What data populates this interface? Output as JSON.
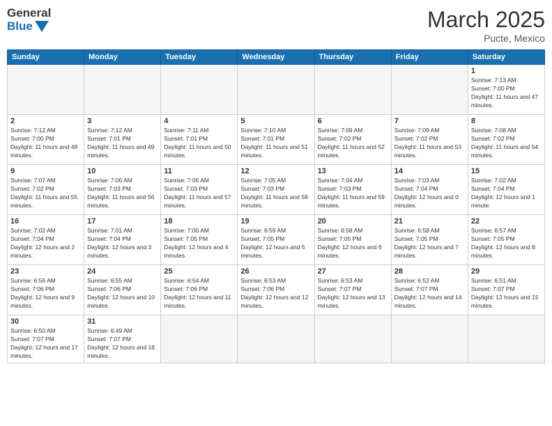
{
  "header": {
    "logo_general": "General",
    "logo_blue": "Blue",
    "month_title": "March 2025",
    "location": "Pucte, Mexico"
  },
  "weekdays": [
    "Sunday",
    "Monday",
    "Tuesday",
    "Wednesday",
    "Thursday",
    "Friday",
    "Saturday"
  ],
  "days": {
    "1": {
      "sunrise": "7:13 AM",
      "sunset": "7:00 PM",
      "daylight": "11 hours and 47 minutes."
    },
    "2": {
      "sunrise": "7:12 AM",
      "sunset": "7:00 PM",
      "daylight": "11 hours and 48 minutes."
    },
    "3": {
      "sunrise": "7:12 AM",
      "sunset": "7:01 PM",
      "daylight": "11 hours and 49 minutes."
    },
    "4": {
      "sunrise": "7:11 AM",
      "sunset": "7:01 PM",
      "daylight": "11 hours and 50 minutes."
    },
    "5": {
      "sunrise": "7:10 AM",
      "sunset": "7:01 PM",
      "daylight": "11 hours and 51 minutes."
    },
    "6": {
      "sunrise": "7:09 AM",
      "sunset": "7:02 PM",
      "daylight": "11 hours and 52 minutes."
    },
    "7": {
      "sunrise": "7:09 AM",
      "sunset": "7:02 PM",
      "daylight": "11 hours and 53 minutes."
    },
    "8": {
      "sunrise": "7:08 AM",
      "sunset": "7:02 PM",
      "daylight": "11 hours and 54 minutes."
    },
    "9": {
      "sunrise": "7:07 AM",
      "sunset": "7:02 PM",
      "daylight": "11 hours and 55 minutes."
    },
    "10": {
      "sunrise": "7:06 AM",
      "sunset": "7:03 PM",
      "daylight": "11 hours and 56 minutes."
    },
    "11": {
      "sunrise": "7:06 AM",
      "sunset": "7:03 PM",
      "daylight": "11 hours and 57 minutes."
    },
    "12": {
      "sunrise": "7:05 AM",
      "sunset": "7:03 PM",
      "daylight": "11 hours and 58 minutes."
    },
    "13": {
      "sunrise": "7:04 AM",
      "sunset": "7:03 PM",
      "daylight": "11 hours and 59 minutes."
    },
    "14": {
      "sunrise": "7:03 AM",
      "sunset": "7:04 PM",
      "daylight": "12 hours and 0 minutes."
    },
    "15": {
      "sunrise": "7:02 AM",
      "sunset": "7:04 PM",
      "daylight": "12 hours and 1 minute."
    },
    "16": {
      "sunrise": "7:02 AM",
      "sunset": "7:04 PM",
      "daylight": "12 hours and 2 minutes."
    },
    "17": {
      "sunrise": "7:01 AM",
      "sunset": "7:04 PM",
      "daylight": "12 hours and 3 minutes."
    },
    "18": {
      "sunrise": "7:00 AM",
      "sunset": "7:05 PM",
      "daylight": "12 hours and 4 minutes."
    },
    "19": {
      "sunrise": "6:59 AM",
      "sunset": "7:05 PM",
      "daylight": "12 hours and 5 minutes."
    },
    "20": {
      "sunrise": "6:58 AM",
      "sunset": "7:05 PM",
      "daylight": "12 hours and 6 minutes."
    },
    "21": {
      "sunrise": "6:58 AM",
      "sunset": "7:05 PM",
      "daylight": "12 hours and 7 minutes."
    },
    "22": {
      "sunrise": "6:57 AM",
      "sunset": "7:05 PM",
      "daylight": "12 hours and 8 minutes."
    },
    "23": {
      "sunrise": "6:56 AM",
      "sunset": "7:06 PM",
      "daylight": "12 hours and 9 minutes."
    },
    "24": {
      "sunrise": "6:55 AM",
      "sunset": "7:06 PM",
      "daylight": "12 hours and 10 minutes."
    },
    "25": {
      "sunrise": "6:54 AM",
      "sunset": "7:06 PM",
      "daylight": "12 hours and 11 minutes."
    },
    "26": {
      "sunrise": "6:53 AM",
      "sunset": "7:06 PM",
      "daylight": "12 hours and 12 minutes."
    },
    "27": {
      "sunrise": "6:53 AM",
      "sunset": "7:07 PM",
      "daylight": "12 hours and 13 minutes."
    },
    "28": {
      "sunrise": "6:52 AM",
      "sunset": "7:07 PM",
      "daylight": "12 hours and 14 minutes."
    },
    "29": {
      "sunrise": "6:51 AM",
      "sunset": "7:07 PM",
      "daylight": "12 hours and 15 minutes."
    },
    "30": {
      "sunrise": "6:50 AM",
      "sunset": "7:07 PM",
      "daylight": "12 hours and 17 minutes."
    },
    "31": {
      "sunrise": "6:49 AM",
      "sunset": "7:07 PM",
      "daylight": "12 hours and 18 minutes."
    }
  }
}
